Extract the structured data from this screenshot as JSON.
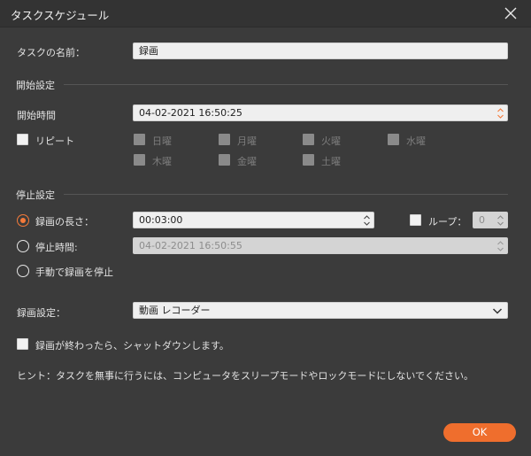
{
  "window": {
    "title": "タスクスケジュール"
  },
  "task_name": {
    "label": "タスクの名前：",
    "value": "録画"
  },
  "start_settings": {
    "heading": "開始設定",
    "start_time_label": "開始時間",
    "start_time_value": "04-02-2021 16:50:25",
    "repeat_label": "リピート",
    "days": [
      "日曜",
      "月曜",
      "火曜",
      "水曜",
      "木曜",
      "金曜",
      "土曜"
    ]
  },
  "stop_settings": {
    "heading": "停止設定",
    "duration_label": "録画の長さ：",
    "duration_value": "00:03:00",
    "loop_label": "ループ：",
    "loop_value": "0",
    "stop_time_label": "停止時間:",
    "stop_time_value": "04-02-2021 16:50:55",
    "manual_label": "手動で録画を停止"
  },
  "record_settings": {
    "label": "録画設定：",
    "selected": "動画 レコーダー"
  },
  "shutdown": {
    "label": "録画が終わったら、シャットダウンします。"
  },
  "hint": {
    "text": "ヒント：タスクを無事に行うには、コンピュータをスリープモードやロックモードにしないでください。"
  },
  "buttons": {
    "ok_label": "OK"
  },
  "colors": {
    "accent": "#ef6e2d",
    "background": "#3b3b3b",
    "titlebar": "#333333"
  }
}
